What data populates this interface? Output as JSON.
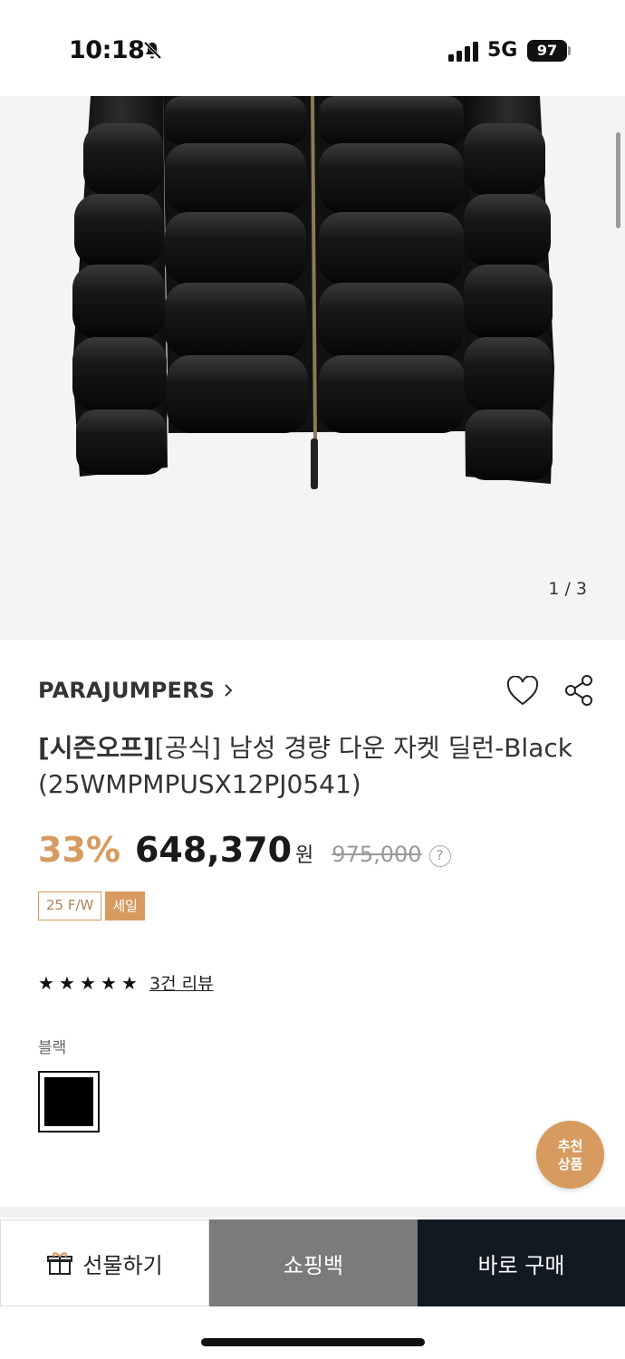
{
  "status_bar": {
    "time": "10:18",
    "network": "5G",
    "battery": "97",
    "icons": [
      "bell-slash-icon",
      "signal-icon"
    ]
  },
  "gallery": {
    "counter": "1 / 3",
    "background": "#f3f4f6"
  },
  "product": {
    "brand": "PARAJUMPERS",
    "title_tag": "[시즌오프]",
    "title": "[공식] 남성 경량 다운 자켓 딜런-Black (25WMPMPUSX12PJ0541)",
    "discount": "33%",
    "price": "648,370",
    "currency": "원",
    "original_price": "975,000",
    "help": "?",
    "badges": {
      "season": "25 F/W",
      "sale": "세일"
    },
    "rating": {
      "stars": 5,
      "review_link": "3건 리뷰"
    },
    "color_label": "블랙",
    "color_swatch": "#000000"
  },
  "recommend": {
    "line1": "추천",
    "line2": "상품"
  },
  "actions": {
    "gift": "선물하기",
    "cart": "쇼핑백",
    "buy": "바로 구매"
  },
  "colors": {
    "accent": "#d79a5f",
    "buy_bg": "#111a22",
    "cart_bg": "#7b7b7b"
  }
}
